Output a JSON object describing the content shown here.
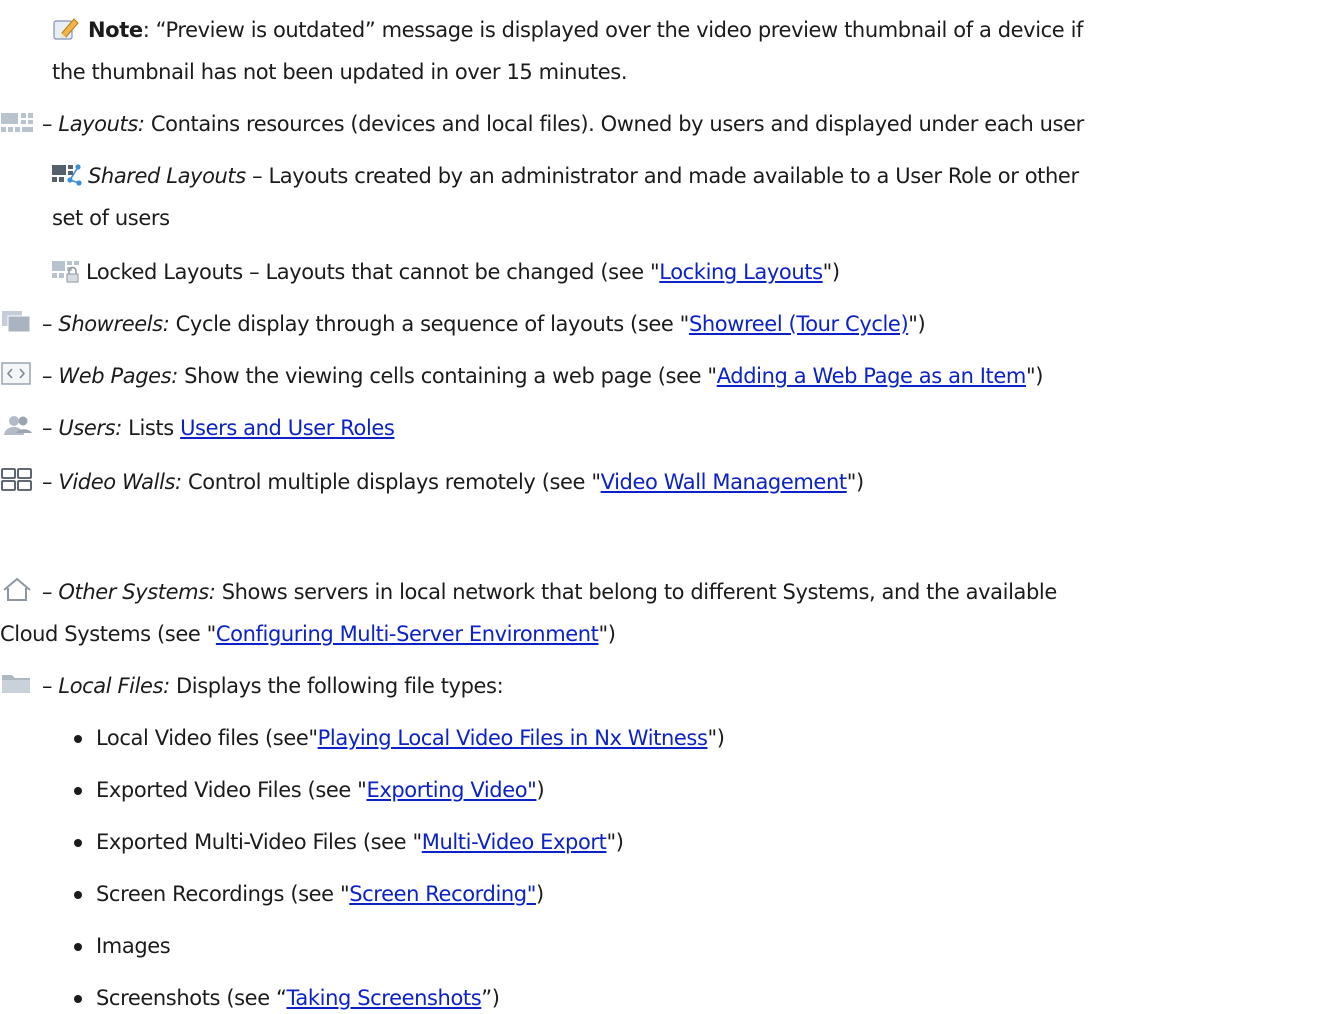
{
  "note": {
    "label": "Note",
    "text_l1": ": “Preview is outdated” message is displayed over the video preview thumbnail of a device if",
    "text_l2": "the thumbnail has not been updated in over 15 minutes."
  },
  "layouts": {
    "dash": "– ",
    "title": "Layouts:",
    "text": " Contains resources (devices and local files). Owned by users and displayed under each user"
  },
  "shared_layouts": {
    "title": "Shared Layouts",
    "text_l1": " – Layouts created by an administrator and made available to a User Role or other",
    "text_l2": "set of users"
  },
  "locked_layouts": {
    "text": "Locked Layouts – Layouts that cannot be changed (see \"",
    "link": "Locking Layouts",
    "end": "\")"
  },
  "showreels": {
    "dash": "– ",
    "title": "Showreels:",
    "text": " Cycle display through a sequence of layouts (see \"",
    "link": "Showreel (Tour Cycle)",
    "end": "\")"
  },
  "web_pages": {
    "dash": "– ",
    "title": "Web Pages:",
    "text": " Show the viewing cells containing a web page (see \"",
    "link": "Adding a Web Page as an Item",
    "end": "\")"
  },
  "users": {
    "dash": "– ",
    "title": "Users:",
    "text": " Lists ",
    "link": "Users and User Roles"
  },
  "video_walls": {
    "dash": "– ",
    "title": "Video Walls:",
    "text": " Control multiple displays remotely (see \"",
    "link": "Video Wall Management",
    "end": "\")"
  },
  "other_systems": {
    "dash": "– ",
    "title": "Other Systems:",
    "text_l1": " Shows servers in local network that belong to different Systems, and the available",
    "text_l2": "Cloud Systems (see \"",
    "link": "Configuring Multi-Server Environment",
    "end": "\")"
  },
  "local_files": {
    "dash": "– ",
    "title": "Local Files:",
    "text": " Displays the following file types:"
  },
  "bullets": [
    {
      "text": "Local Video files (see\"",
      "link": "Playing Local Video Files in Nx Witness",
      "end": "\")"
    },
    {
      "text": "Exported Video Files (see \"",
      "link": "Exporting Video\"",
      "end": ")"
    },
    {
      "text": "Exported Multi-Video Files (see \"",
      "link": "Multi-Video Export",
      "end": "\")"
    },
    {
      "text": "Screen Recordings (see \"",
      "link": "Screen Recording\"",
      "end": ")"
    },
    {
      "text": "Images",
      "link": "",
      "end": ""
    },
    {
      "text": "Screenshots (see “",
      "link": "Taking Screenshots",
      "end": "”)"
    }
  ],
  "icons": {
    "note": "note-pencil-icon",
    "layouts": "layouts-icon",
    "shared": "shared-layouts-icon",
    "locked": "locked-layouts-icon",
    "showreels": "showreels-icon",
    "web": "web-page-icon",
    "users": "users-icon",
    "video_walls": "video-wall-icon",
    "other_systems": "house-icon",
    "local_files": "folder-icon"
  }
}
